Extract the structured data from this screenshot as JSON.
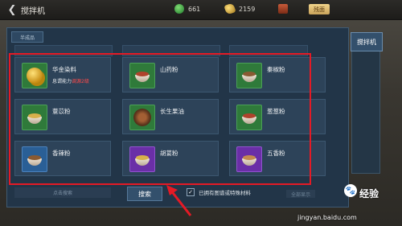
{
  "topbar": {
    "title": "搅拌机",
    "resources": {
      "green_value": "661",
      "gold_value": "2159",
      "button_label": "残面"
    }
  },
  "panel": {
    "section_label": "半成品",
    "side_tab_label": "搅拌机"
  },
  "items": [
    {
      "name": "华金染料",
      "sub_prefix": "息谓能力",
      "sub_req": "调源2级",
      "icon": "gold-coin-icon",
      "color": "green"
    },
    {
      "name": "山药粉",
      "icon": "bowl-icon",
      "color": "green"
    },
    {
      "name": "秦椒粉",
      "icon": "bowl-icon",
      "color": "green"
    },
    {
      "name": "薏苡粉",
      "icon": "bowl-icon",
      "color": "green"
    },
    {
      "name": "长生果油",
      "icon": "dish-icon",
      "color": "green"
    },
    {
      "name": "葱葱粉",
      "icon": "bowl-icon",
      "color": "green"
    },
    {
      "name": "香辣粉",
      "icon": "bowl-icon",
      "color": "blue"
    },
    {
      "name": "胡荽粉",
      "icon": "bowl-icon",
      "color": "purple"
    },
    {
      "name": "五香粉",
      "icon": "bowl-icon",
      "color": "purple"
    }
  ],
  "bottom": {
    "left_hint": "点击搜索",
    "search_label": "搜索",
    "checkbox_label": "已拥有图谱或特殊材料",
    "checkbox_checked": true,
    "right_label": "全部显示"
  },
  "watermark": {
    "title": "经验",
    "url": "jingyan.baidu.com"
  },
  "colors": {
    "highlight": "#e51a25",
    "panel_bg": "#223548",
    "green_icon": "#2f7a3a",
    "blue_icon": "#2a5f96",
    "purple_icon": "#6a2fa7",
    "requirement_text": "#ff4a4a"
  }
}
